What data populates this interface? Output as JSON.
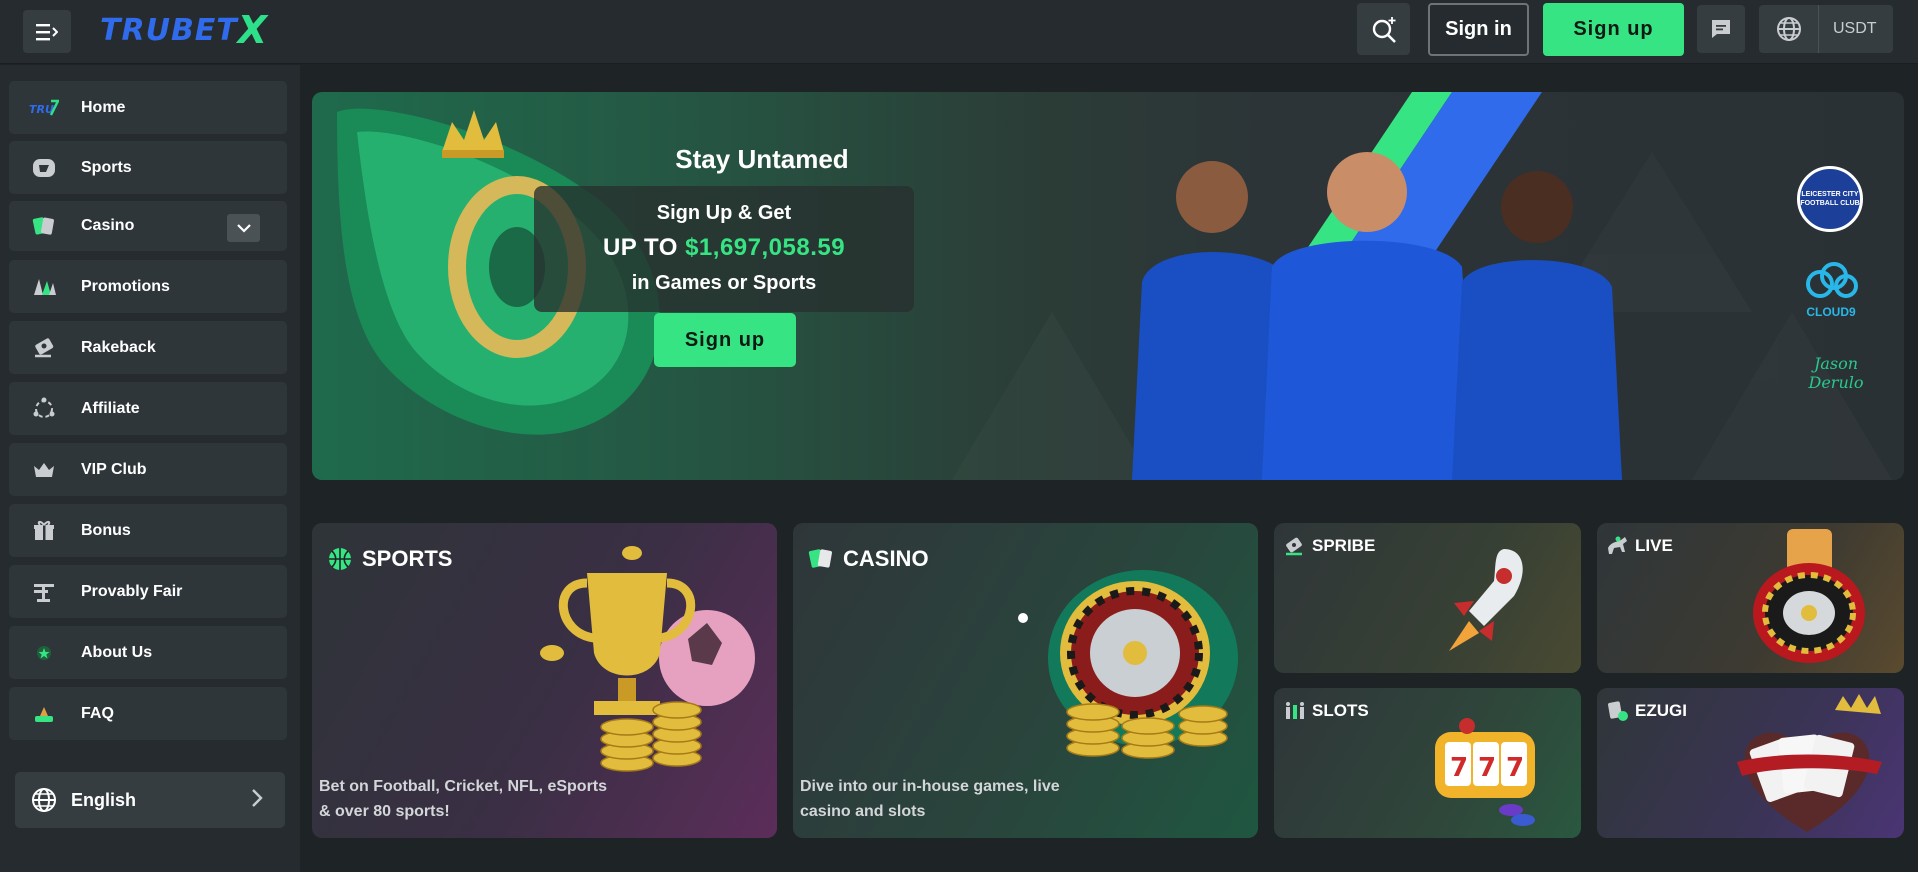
{
  "header": {
    "logo_part1": "TRU",
    "logo_part2": "BET",
    "logo_part3": "X",
    "signin_label": "Sign in",
    "signup_label": "Sign up",
    "currency": "USDT"
  },
  "sidebar": {
    "items": [
      {
        "label": "Home",
        "icon": "home-logo-icon"
      },
      {
        "label": "Sports",
        "icon": "sports-icon"
      },
      {
        "label": "Casino",
        "icon": "casino-cards-icon"
      },
      {
        "label": "Promotions",
        "icon": "promotions-icon"
      },
      {
        "label": "Rakeback",
        "icon": "rakeback-icon"
      },
      {
        "label": "Affiliate",
        "icon": "affiliate-icon"
      },
      {
        "label": "VIP Club",
        "icon": "crown-icon"
      },
      {
        "label": "Bonus",
        "icon": "gift-icon"
      },
      {
        "label": "Provably Fair",
        "icon": "scale-icon"
      },
      {
        "label": "About Us",
        "icon": "about-icon"
      },
      {
        "label": "FAQ",
        "icon": "faq-icon"
      }
    ],
    "language": "English"
  },
  "hero": {
    "title": "Stay Untamed",
    "line1": "Sign Up & Get",
    "line2_prefix": "UP TO",
    "line2_amount": "$1,697,058.59",
    "line3": "in Games or Sports",
    "button_label": "Sign up",
    "partner_badges": [
      "LEICESTER CITY FOOTBALL CLUB",
      "CLOUD9",
      "Jason Derulo"
    ]
  },
  "cards": {
    "sports": {
      "title": "SPORTS",
      "desc1": "Bet on Football, Cricket, NFL, eSports",
      "desc2": "& over 80 sports!"
    },
    "casino": {
      "title": "CASINO",
      "desc1": "Dive into our in-house games, live",
      "desc2": "casino and slots"
    },
    "spribe": {
      "title": "SPRIBE"
    },
    "live": {
      "title": "LIVE"
    },
    "slots": {
      "title": "SLOTS"
    },
    "ezugi": {
      "title": "EZUGI"
    }
  },
  "colors": {
    "accent": "#37e483",
    "brand_blue": "#2f6bea",
    "bg": "#1e2326",
    "panel": "#2f363a"
  }
}
